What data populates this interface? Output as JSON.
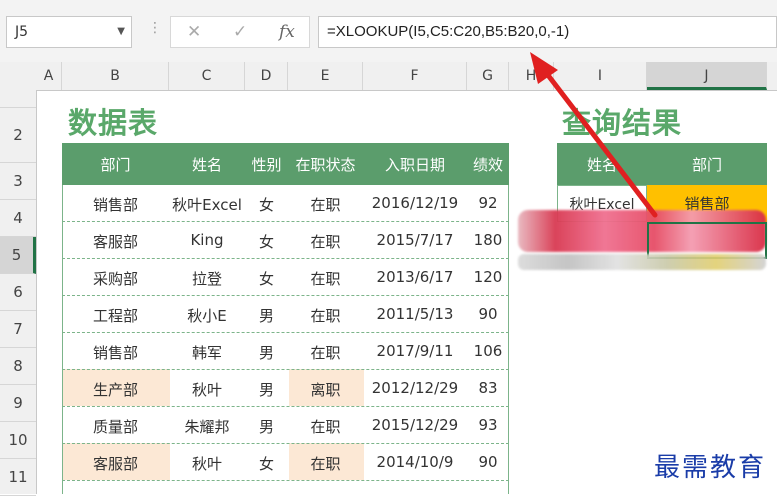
{
  "formula_bar": {
    "name_box": "J5",
    "fx_label": "fx",
    "cancel_glyph": "✕",
    "enter_glyph": "✓",
    "formula": "=XLOOKUP(I5,C5:C20,B5:B20,0,-1)"
  },
  "columns": [
    "A",
    "B",
    "C",
    "D",
    "E",
    "F",
    "G",
    "H",
    "I",
    "J"
  ],
  "rows": [
    "",
    "2",
    "3",
    "4",
    "5",
    "6",
    "7",
    "8",
    "9",
    "10",
    "11"
  ],
  "left_title": "数据表",
  "right_title": "查询结果",
  "main_table": {
    "headers": [
      "部门",
      "姓名",
      "性别",
      "在职状态",
      "入职日期",
      "绩效"
    ],
    "rows": [
      [
        "销售部",
        "秋叶Excel",
        "女",
        "在职",
        "2016/12/19",
        "92"
      ],
      [
        "客服部",
        "King",
        "女",
        "在职",
        "2015/7/17",
        "180"
      ],
      [
        "采购部",
        "拉登",
        "女",
        "在职",
        "2013/6/17",
        "120"
      ],
      [
        "工程部",
        "秋小E",
        "男",
        "在职",
        "2011/5/13",
        "90"
      ],
      [
        "销售部",
        "韩军",
        "男",
        "在职",
        "2017/9/11",
        "106"
      ],
      [
        "生产部",
        "秋叶",
        "男",
        "离职",
        "2012/12/29",
        "83"
      ],
      [
        "质量部",
        "朱耀邦",
        "男",
        "在职",
        "2015/12/29",
        "93"
      ],
      [
        "客服部",
        "秋叶",
        "女",
        "在职",
        "2014/10/9",
        "90"
      ]
    ]
  },
  "result_table": {
    "headers": [
      "姓名",
      "部门"
    ],
    "row1": [
      "秋叶Excel",
      "销售部"
    ]
  },
  "watermark": "最需教育",
  "colors": {
    "header_green": "#5b9d6c",
    "title_green": "#5aa86a",
    "peach": "#fce8d5",
    "yellow": "#ffc000",
    "arrow_red": "#e02020"
  }
}
